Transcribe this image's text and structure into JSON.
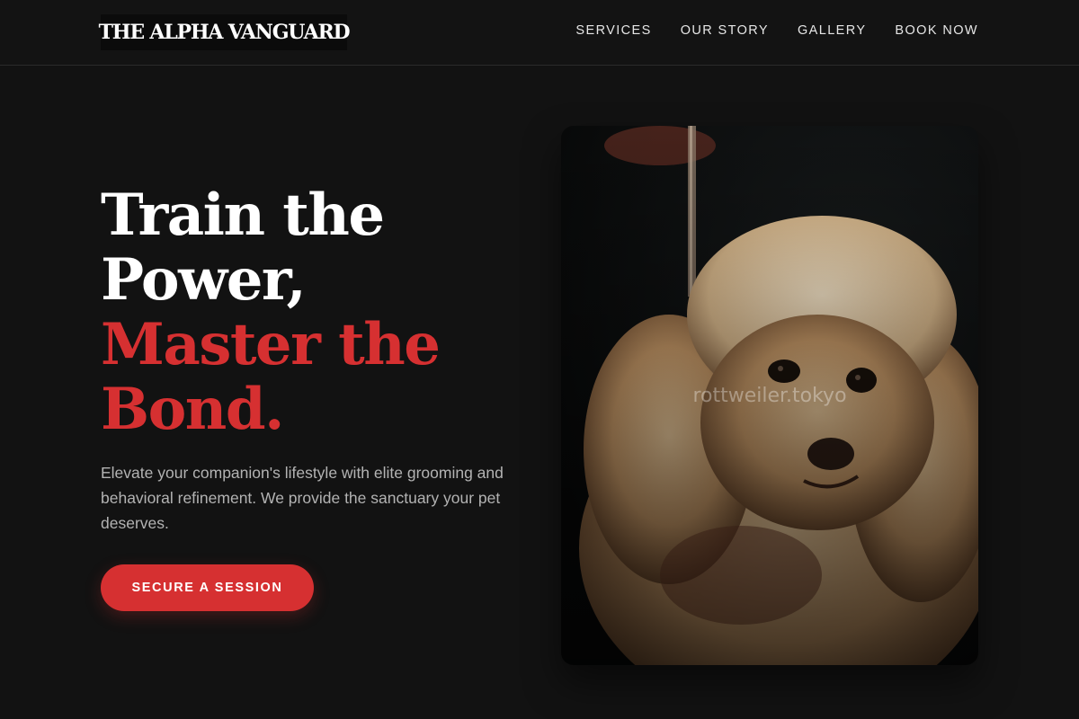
{
  "brand": {
    "logo_text": "THE ALPHA VANGUARD"
  },
  "nav": {
    "items": [
      {
        "label": "SERVICES"
      },
      {
        "label": "OUR STORY"
      },
      {
        "label": "GALLERY"
      },
      {
        "label": "BOOK NOW"
      }
    ]
  },
  "hero": {
    "title_line1": "Train the",
    "title_line2": "Power,",
    "title_line3": "Master the",
    "title_line4": "Bond.",
    "description": "Elevate your companion's lifestyle with elite grooming and behavioral refinement. We provide the sanctuary your pet deserves.",
    "cta_label": "SECURE A SESSION"
  },
  "photo": {
    "subject": "poodle-photo",
    "watermark": "rottweiler.tokyo"
  },
  "colors": {
    "background": "#121212",
    "accent": "#d63031",
    "text": "#ffffff",
    "muted_text": "#b3b3b3"
  }
}
